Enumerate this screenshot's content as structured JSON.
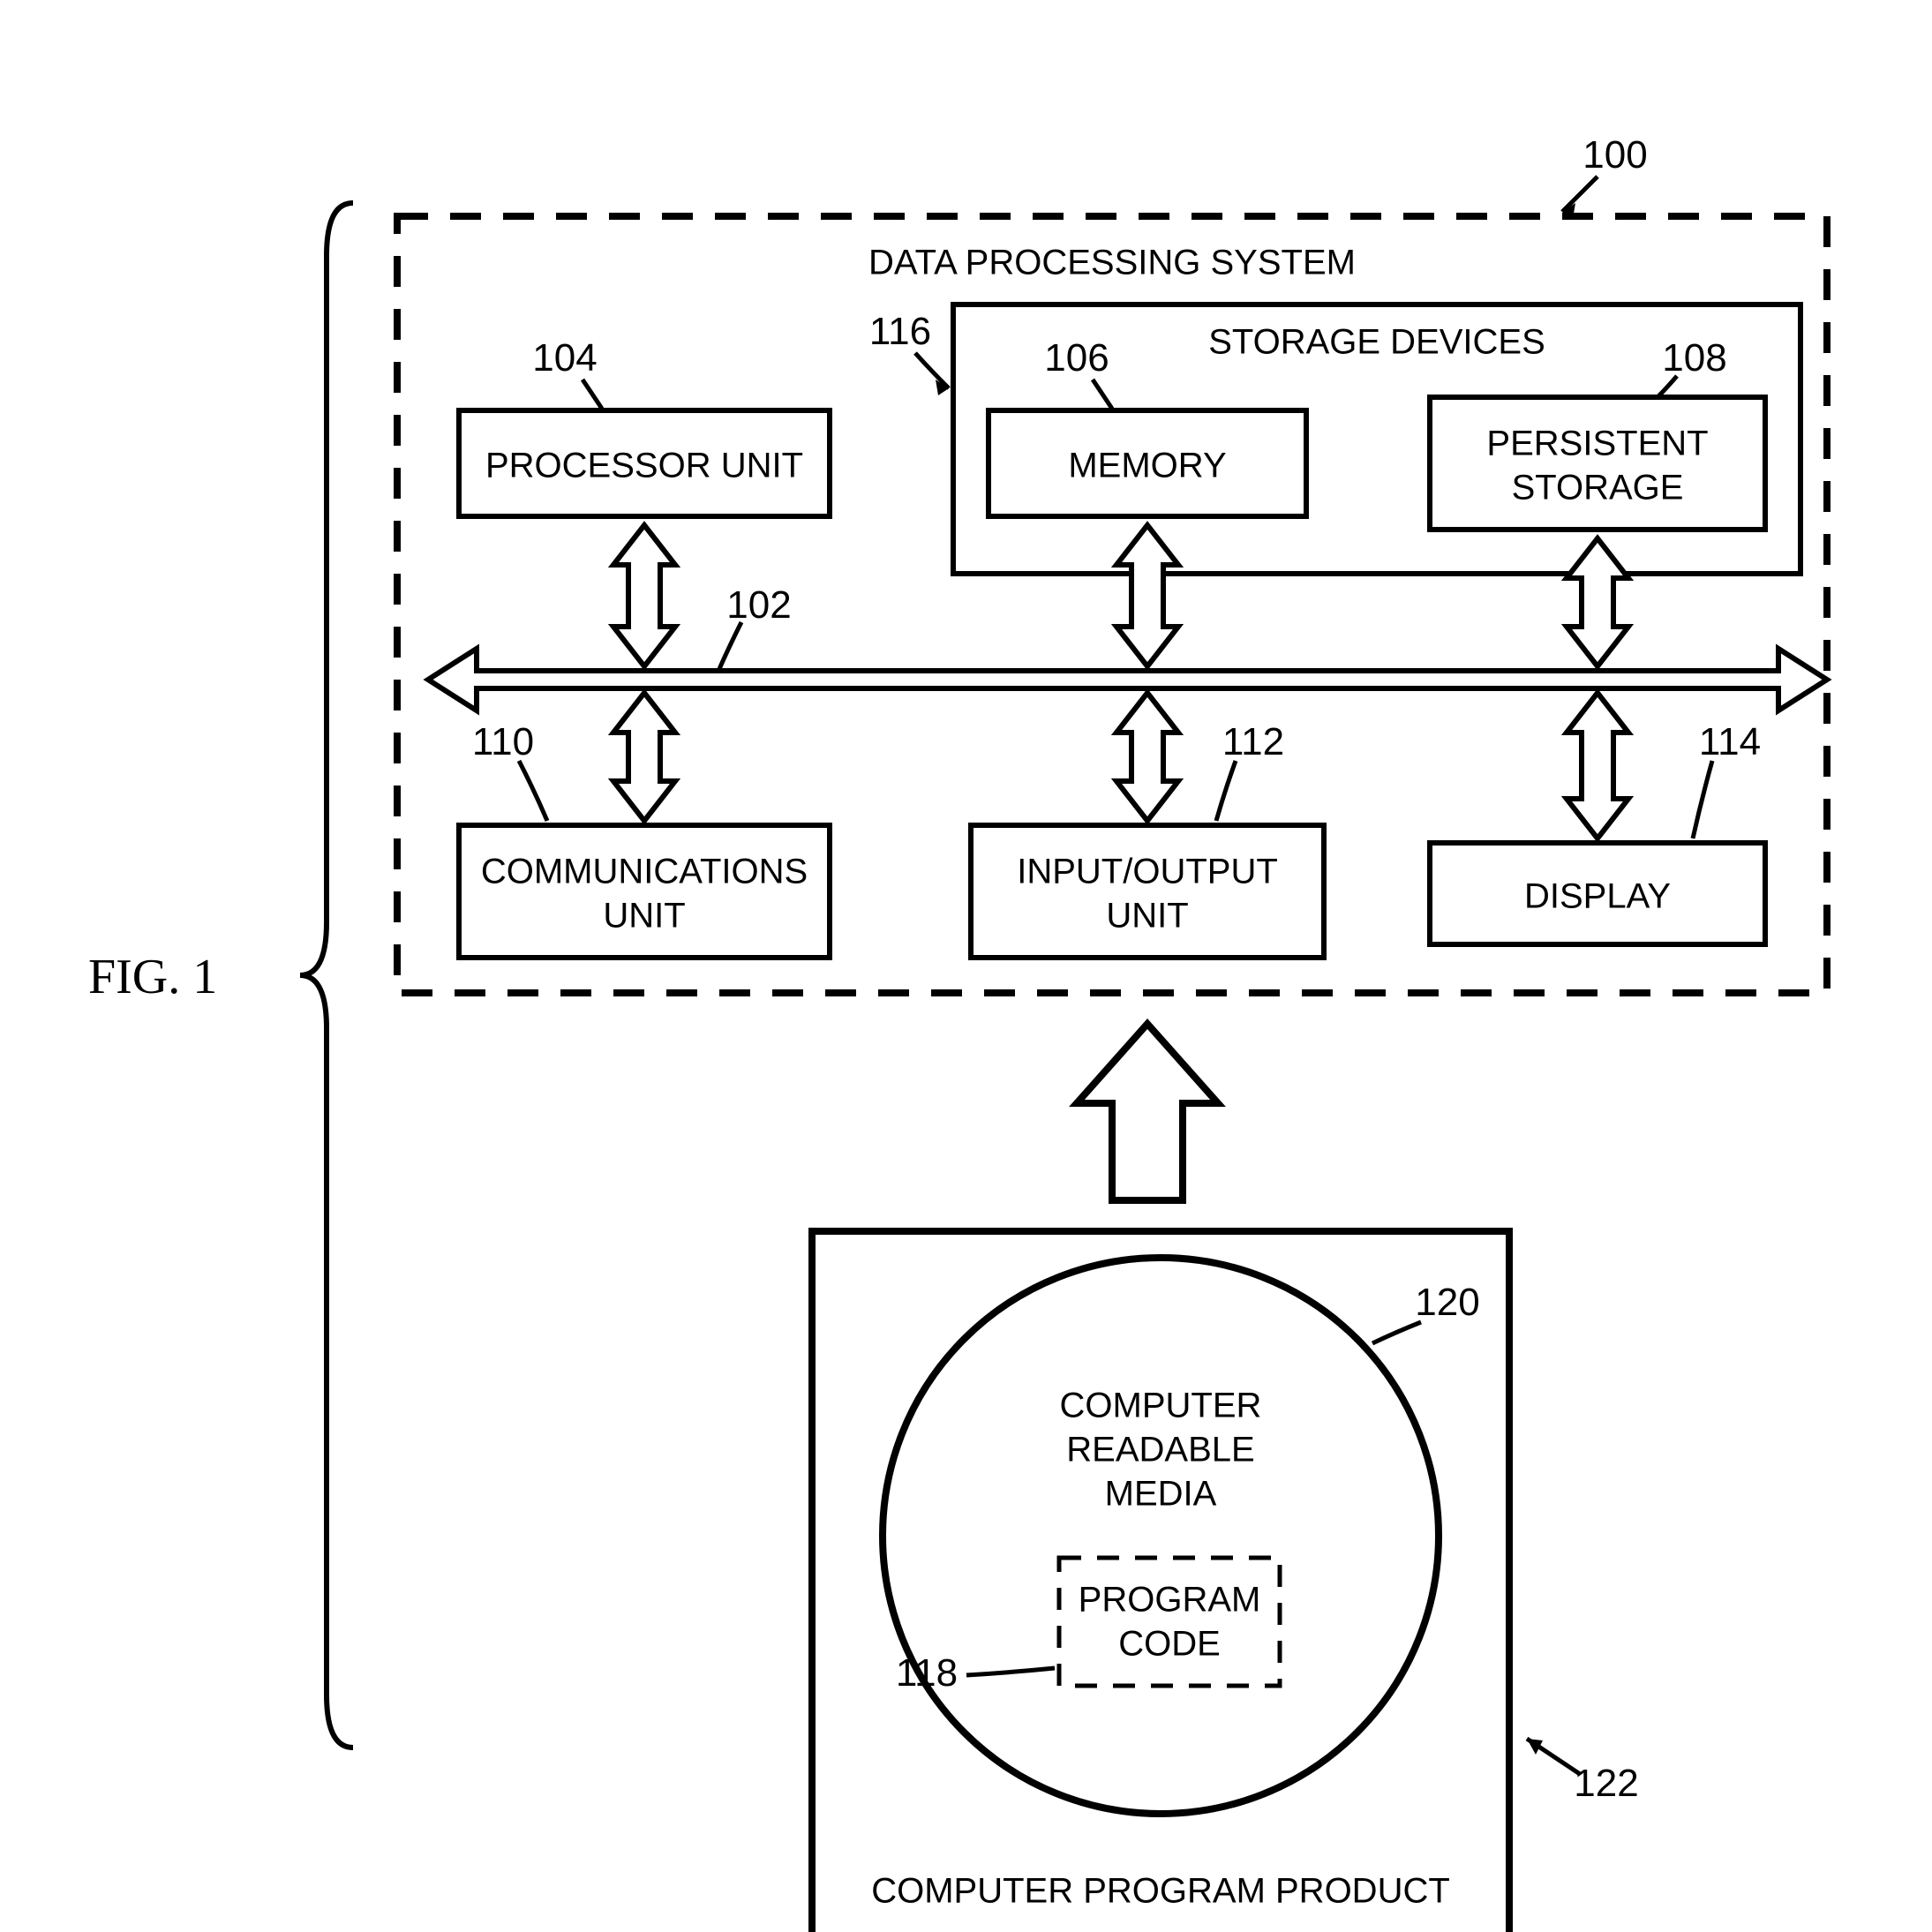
{
  "figure_label": "FIG. 1",
  "system": {
    "title": "DATA PROCESSING SYSTEM",
    "ref": "100",
    "bus_ref": "102",
    "processor": {
      "label": "PROCESSOR UNIT",
      "ref": "104"
    },
    "storage_devices": {
      "title": "STORAGE DEVICES",
      "ref": "116",
      "memory": {
        "label": "MEMORY",
        "ref": "106"
      },
      "persistent": {
        "label_line1": "PERSISTENT",
        "label_line2": "STORAGE",
        "ref": "108"
      }
    },
    "communications": {
      "label_line1": "COMMUNICATIONS",
      "label_line2": "UNIT",
      "ref": "110"
    },
    "io_unit": {
      "label_line1": "INPUT/OUTPUT",
      "label_line2": "UNIT",
      "ref": "112"
    },
    "display": {
      "label": "DISPLAY",
      "ref": "114"
    }
  },
  "product": {
    "title": "COMPUTER PROGRAM PRODUCT",
    "ref": "122",
    "media": {
      "line1": "COMPUTER",
      "line2": "READABLE",
      "line3": "MEDIA",
      "ref": "120"
    },
    "code": {
      "line1": "PROGRAM",
      "line2": "CODE",
      "ref": "118"
    }
  }
}
